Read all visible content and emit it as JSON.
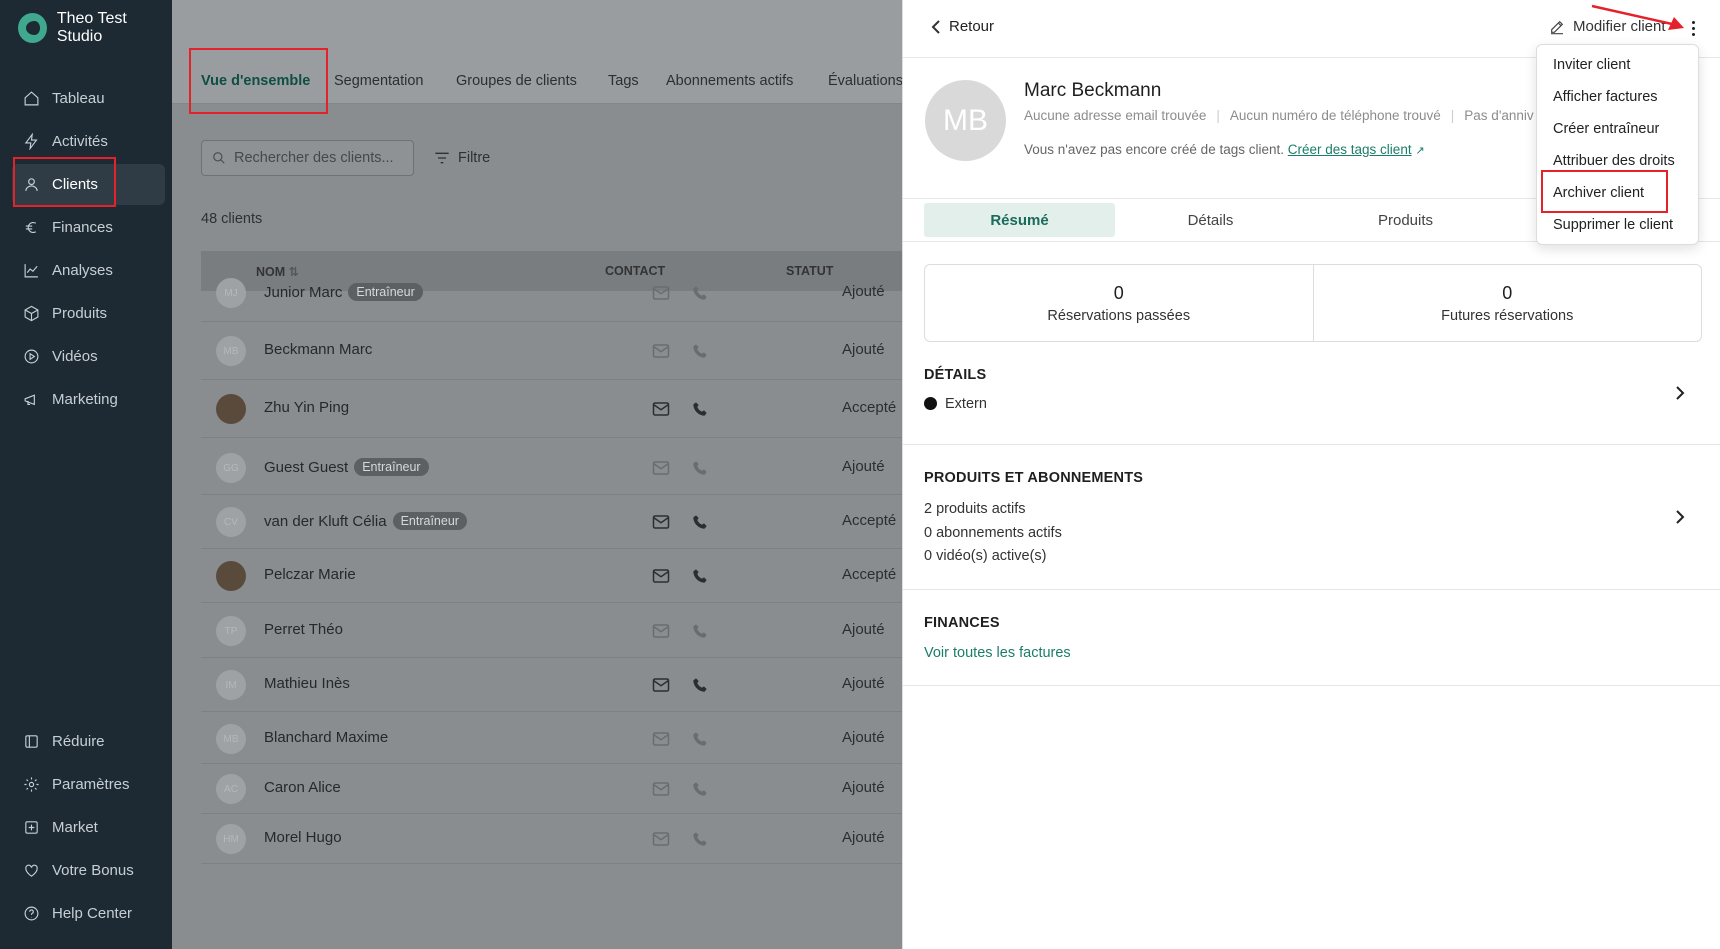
{
  "app": {
    "name": "Theo Test Studio"
  },
  "sidebar": {
    "items": [
      {
        "label": "Tableau",
        "icon": "home-icon"
      },
      {
        "label": "Activités",
        "icon": "lightning-icon"
      },
      {
        "label": "Clients",
        "icon": "user-icon"
      },
      {
        "label": "Finances",
        "icon": "euro-icon"
      },
      {
        "label": "Analyses",
        "icon": "chart-line-icon"
      },
      {
        "label": "Produits",
        "icon": "box-icon"
      },
      {
        "label": "Vidéos",
        "icon": "play-circle-icon"
      },
      {
        "label": "Marketing",
        "icon": "megaphone-icon"
      }
    ],
    "footer_items": [
      {
        "label": "Réduire",
        "icon": "collapse-icon"
      },
      {
        "label": "Paramètres",
        "icon": "gear-icon"
      },
      {
        "label": "Market",
        "icon": "plus-square-icon"
      },
      {
        "label": "Votre Bonus",
        "icon": "heart-icon"
      },
      {
        "label": "Help Center",
        "icon": "help-icon"
      }
    ],
    "active": "Clients"
  },
  "main": {
    "tabs": [
      "Vue d'ensemble",
      "Segmentation",
      "Groupes de clients",
      "Tags",
      "Abonnements actifs",
      "Évaluations"
    ],
    "search_placeholder": "Rechercher des clients...",
    "filter_label": "Filtre",
    "count_label": "48 clients",
    "columns": {
      "name": "NOM",
      "contact": "CONTACT",
      "status": "STATUT"
    },
    "rows": [
      {
        "initials": "MJ",
        "name": "Junior Marc",
        "badge": "Entraîneur",
        "status": "Ajouté"
      },
      {
        "initials": "MB",
        "name": "Beckmann Marc",
        "badge": "",
        "status": "Ajouté"
      },
      {
        "initials": "",
        "name": "Zhu Yin Ping",
        "badge": "",
        "status": "Accepté"
      },
      {
        "initials": "GG",
        "name": "Guest Guest",
        "badge": "Entraîneur",
        "status": "Ajouté"
      },
      {
        "initials": "CV",
        "name": "van der Kluft Célia",
        "badge": "Entraîneur",
        "status": "Accepté"
      },
      {
        "initials": "",
        "name": "Pelczar Marie",
        "badge": "",
        "status": "Accepté"
      },
      {
        "initials": "TP",
        "name": "Perret Théo",
        "badge": "",
        "status": "Ajouté"
      },
      {
        "initials": "IM",
        "name": "Mathieu Inès",
        "badge": "",
        "status": "Ajouté"
      },
      {
        "initials": "MB",
        "name": "Blanchard Maxime",
        "badge": "",
        "status": "Ajouté"
      },
      {
        "initials": "AC",
        "name": "Caron Alice",
        "badge": "",
        "status": "Ajouté"
      },
      {
        "initials": "HM",
        "name": "Morel Hugo",
        "badge": "",
        "status": "Ajouté"
      }
    ]
  },
  "panel": {
    "back_label": "Retour",
    "edit_label": "Modifier client",
    "initials": "MB",
    "client_name": "Marc Beckmann",
    "info": [
      "Aucune adresse email trouvée",
      "Aucun numéro de téléphone trouvé",
      "Pas d'anniv"
    ],
    "tags_text": "Vous n'avez pas encore créé de tags client.",
    "tags_link": "Créer des tags client",
    "tabs": [
      "Résumé",
      "Détails",
      "Produits"
    ],
    "stats": [
      {
        "value": "0",
        "label": "Réservations passées"
      },
      {
        "value": "0",
        "label": "Futures réservations"
      }
    ],
    "details": {
      "title": "DÉTAILS",
      "value": "Extern"
    },
    "products": {
      "title": "PRODUITS ET ABONNEMENTS",
      "lines": [
        "2 produits actifs",
        "0 abonnements actifs",
        "0 vidéo(s) active(s)"
      ]
    },
    "finances": {
      "title": "FINANCES",
      "link": "Voir toutes les factures"
    }
  },
  "menu": {
    "items": [
      "Inviter client",
      "Afficher factures",
      "Créer entraîneur",
      "Attribuer des droits",
      "Archiver client",
      "Supprimer le client"
    ]
  },
  "colors": {
    "accent": "#1a7d6a",
    "sidebar": "#1d2a33",
    "highlight": "#e3222a"
  }
}
